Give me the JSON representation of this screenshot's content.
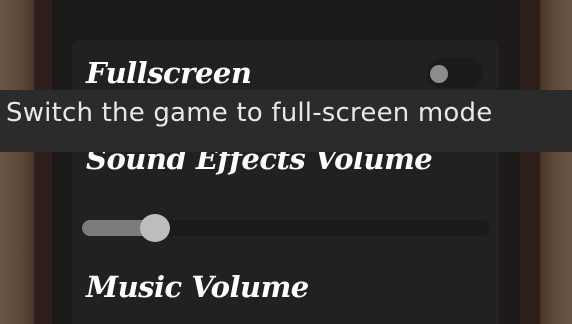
{
  "settings": {
    "fullscreen": {
      "label": "Fullscreen",
      "enabled": false
    },
    "sound_effects_volume": {
      "label": "Sound Effects Volume",
      "level": 0.18
    },
    "music_volume": {
      "label": "Music Volume"
    }
  },
  "tooltip": {
    "text": "Switch the game to full-screen mode"
  },
  "colors": {
    "panel": "#222121",
    "slider_fill": "#7c7c7c",
    "slider_thumb": "#bdbdbd",
    "tooltip_bg": "#2b2b2b"
  }
}
